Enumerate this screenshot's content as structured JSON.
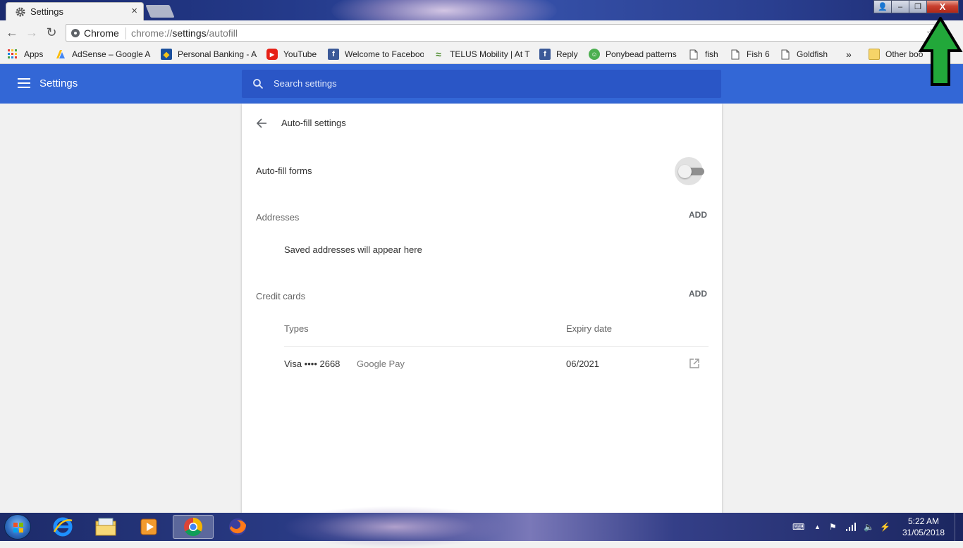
{
  "browser": {
    "tab_title": "Settings",
    "tab_close": "×",
    "window_buttons": {
      "user": "👤",
      "minimize": "–",
      "restore": "❐",
      "close": "X"
    },
    "omnibox": {
      "chip": "Chrome",
      "url_prefix": "chrome://",
      "url_host": "settings",
      "url_path": "/autofill"
    },
    "bookmarks": [
      {
        "label": "Apps",
        "icon": "apps-grid-icon"
      },
      {
        "label": "AdSense – Google A",
        "icon": "adsense-icon"
      },
      {
        "label": "Personal Banking - A",
        "icon": "bank-icon"
      },
      {
        "label": "YouTube",
        "icon": "youtube-icon"
      },
      {
        "label": "Welcome to Faceboo",
        "icon": "facebook-icon"
      },
      {
        "label": "TELUS Mobility | At T",
        "icon": "telus-icon"
      },
      {
        "label": "Reply",
        "icon": "facebook-icon"
      },
      {
        "label": "Ponybead patterns",
        "icon": "ponybead-icon"
      },
      {
        "label": "fish",
        "icon": "page-icon"
      },
      {
        "label": "Fish 6",
        "icon": "page-icon"
      },
      {
        "label": "Goldfish",
        "icon": "page-icon"
      }
    ],
    "overflow": "»",
    "other_bookmarks": "Other boo"
  },
  "settings": {
    "header_title": "Settings",
    "search_placeholder": "Search settings",
    "page_title": "Auto-fill settings",
    "autofill_forms_label": "Auto-fill forms",
    "autofill_forms_enabled": false,
    "addresses": {
      "heading": "Addresses",
      "add_label": "ADD",
      "empty_text": "Saved addresses will appear here"
    },
    "credit_cards": {
      "heading": "Credit cards",
      "add_label": "ADD",
      "columns": {
        "types": "Types",
        "expiry": "Expiry date"
      },
      "rows": [
        {
          "card": "Visa •••• 2668",
          "source": "Google Pay",
          "expiry": "06/2021"
        }
      ]
    }
  },
  "taskbar": {
    "time": "5:22 AM",
    "date": "31/05/2018",
    "apps": [
      "internet-explorer-icon",
      "file-explorer-icon",
      "media-player-icon",
      "chrome-icon",
      "firefox-icon"
    ]
  },
  "colors": {
    "header_blue": "#3367d6",
    "search_blue": "#2a56c6",
    "arrow_green": "#22a83a"
  }
}
